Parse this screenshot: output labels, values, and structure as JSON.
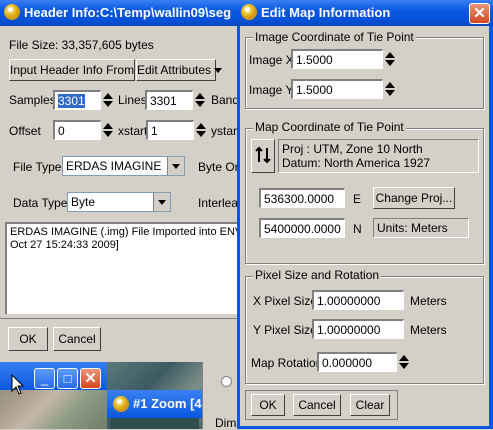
{
  "header_window": {
    "title": "Header Info:C:\\Temp\\wallin09\\seg",
    "file_size": "File Size: 33,357,605 bytes",
    "input_header_btn": "Input Header Info From",
    "edit_attributes_btn": "Edit Attributes",
    "samples_label": "Samples",
    "samples_value": "3301",
    "lines_label": "Lines",
    "lines_value": "3301",
    "bands_label": "Band",
    "offset_label": "Offset",
    "offset_value": "0",
    "xstart_label": "xstart",
    "xstart_value": "1",
    "ystart_label": "ystart",
    "file_type_label": "File Type",
    "file_type_value": "ERDAS IMAGINE",
    "byte_order_label": "Byte Ord",
    "data_type_label": "Data Type",
    "data_type_value": "Byte",
    "interleave_label": "Interleav",
    "description_line1": "ERDAS IMAGINE (.img) File Imported into ENVI",
    "description_line2": "Oct 27 15:24:33 2009]",
    "ok": "OK",
    "cancel": "Cancel"
  },
  "map_dialog": {
    "title": "Edit Map Information",
    "image_coord_group": "Image Coordinate of Tie Point",
    "image_x_label": "Image X",
    "image_x_value": "1.5000",
    "image_y_label": "Image Y",
    "image_y_value": "1.5000",
    "map_coord_group": "Map Coordinate of Tie Point",
    "proj_line1": "Proj : UTM, Zone 10 North",
    "proj_line2": "Datum: North America 1927",
    "easting_value": "536300.0000",
    "easting_unit": "E",
    "change_proj": "Change Proj...",
    "northing_value": "5400000.0000",
    "northing_unit": "N",
    "units_text": "Units: Meters",
    "pixel_group": "Pixel Size and Rotation",
    "x_pixel_label": "X Pixel Size",
    "x_pixel_value": "1.00000000",
    "x_pixel_unit": "Meters",
    "y_pixel_label": "Y Pixel Size",
    "y_pixel_value": "1.00000000",
    "y_pixel_unit": "Meters",
    "rotation_label": "Map Rotation",
    "rotation_value": "0.000000",
    "ok": "OK",
    "cancel": "Cancel",
    "clear": "Clear"
  },
  "bottom": {
    "zoom_title": "#1 Zoom [4",
    "dims_label": "Dims"
  },
  "colors": {
    "xp_blue": "#0a58e0",
    "dialog_bg": "#d4d0c8",
    "close_red": "#d6461f"
  }
}
